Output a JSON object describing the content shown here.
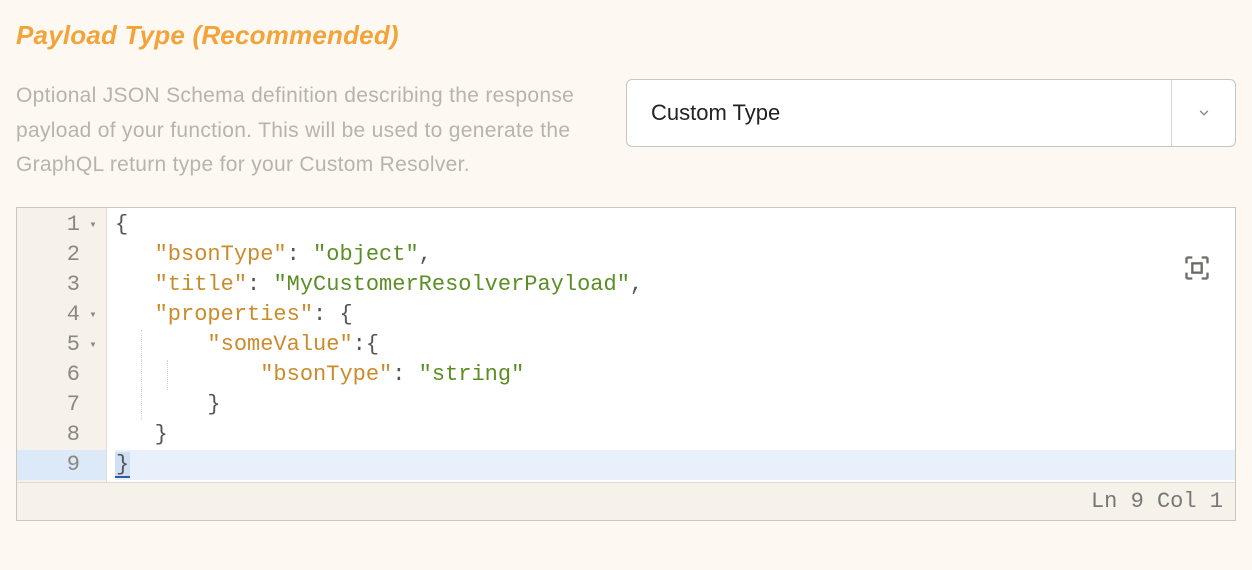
{
  "section": {
    "title": "Payload Type (Recommended)",
    "description": "Optional JSON Schema definition describing the response payload of your function. This will be used to generate the GraphQL return type for your Custom Resolver."
  },
  "select": {
    "value": "Custom Type"
  },
  "editor": {
    "cursor_line": 9,
    "lines": [
      {
        "n": "1",
        "foldable": true,
        "tokens": [
          {
            "t": "punc",
            "v": "{"
          }
        ]
      },
      {
        "n": "2",
        "foldable": false,
        "tokens": [
          {
            "t": "ws",
            "v": "   "
          },
          {
            "t": "key",
            "v": "\"bsonType\""
          },
          {
            "t": "punc",
            "v": ": "
          },
          {
            "t": "str",
            "v": "\"object\""
          },
          {
            "t": "punc",
            "v": ","
          }
        ]
      },
      {
        "n": "3",
        "foldable": false,
        "tokens": [
          {
            "t": "ws",
            "v": "   "
          },
          {
            "t": "key",
            "v": "\"title\""
          },
          {
            "t": "punc",
            "v": ": "
          },
          {
            "t": "str",
            "v": "\"MyCustomerResolverPayload\""
          },
          {
            "t": "punc",
            "v": ","
          }
        ]
      },
      {
        "n": "4",
        "foldable": true,
        "tokens": [
          {
            "t": "ws",
            "v": "   "
          },
          {
            "t": "key",
            "v": "\"properties\""
          },
          {
            "t": "punc",
            "v": ": {"
          }
        ]
      },
      {
        "n": "5",
        "foldable": true,
        "tokens": [
          {
            "t": "ws",
            "v": "       "
          },
          {
            "t": "key",
            "v": "\"someValue\""
          },
          {
            "t": "punc",
            "v": ":{"
          }
        ]
      },
      {
        "n": "6",
        "foldable": false,
        "tokens": [
          {
            "t": "ws",
            "v": "           "
          },
          {
            "t": "key",
            "v": "\"bsonType\""
          },
          {
            "t": "punc",
            "v": ": "
          },
          {
            "t": "str",
            "v": "\"string\""
          }
        ]
      },
      {
        "n": "7",
        "foldable": false,
        "tokens": [
          {
            "t": "ws",
            "v": "       "
          },
          {
            "t": "punc",
            "v": "}"
          }
        ]
      },
      {
        "n": "8",
        "foldable": false,
        "tokens": [
          {
            "t": "ws",
            "v": "   "
          },
          {
            "t": "punc",
            "v": "}"
          }
        ]
      },
      {
        "n": "9",
        "foldable": false,
        "tokens": [
          {
            "t": "cursor",
            "v": "}"
          }
        ]
      }
    ],
    "status": {
      "ln_label": "Ln",
      "ln": "9",
      "col_label": "Col",
      "col": "1"
    }
  }
}
